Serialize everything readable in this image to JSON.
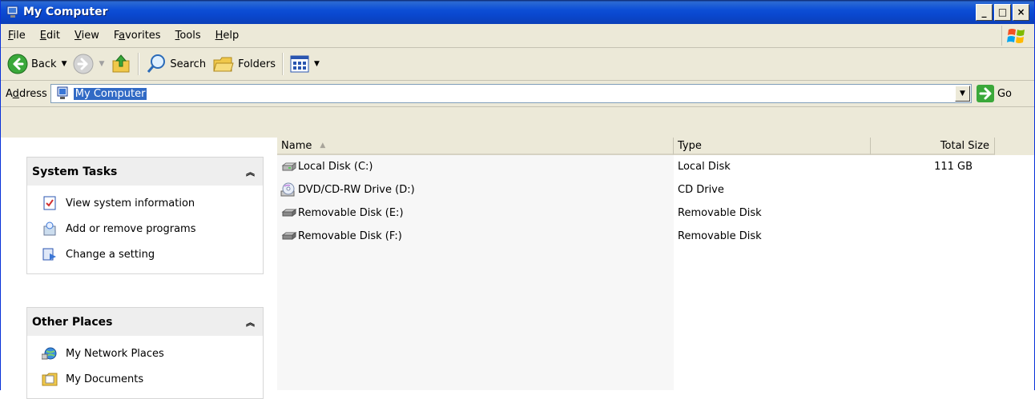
{
  "window": {
    "title": "My Computer",
    "minimize_glyph": "_",
    "maximize_glyph": "□",
    "close_glyph": "×"
  },
  "menu": {
    "items": [
      {
        "key": "F",
        "rest": "ile"
      },
      {
        "key": "E",
        "rest": "dit"
      },
      {
        "key": "V",
        "rest": "iew"
      },
      {
        "pre": "F",
        "key": "a",
        "rest": "vorites"
      },
      {
        "key": "T",
        "rest": "ools"
      },
      {
        "key": "H",
        "rest": "elp"
      }
    ]
  },
  "toolbar": {
    "back_label": "Back",
    "search_label": "Search",
    "folders_label": "Folders"
  },
  "address": {
    "label_pre": "A",
    "label_key": "d",
    "label_rest": "dress",
    "value": "My Computer",
    "go_label": "Go"
  },
  "tasks": {
    "system_title": "System Tasks",
    "system_items": [
      "View system information",
      "Add or remove programs",
      "Change a setting"
    ],
    "other_title": "Other Places",
    "other_items": [
      "My Network Places",
      "My Documents"
    ]
  },
  "list": {
    "columns": {
      "name": "Name",
      "type": "Type",
      "size": "Total Size"
    },
    "rows": [
      {
        "name": "Local Disk (C:)",
        "type": "Local Disk",
        "size": "111 GB",
        "icon": "hard-drive-icon"
      },
      {
        "name": "DVD/CD-RW Drive (D:)",
        "type": "CD Drive",
        "size": "",
        "icon": "cd-drive-icon"
      },
      {
        "name": "Removable Disk (E:)",
        "type": "Removable Disk",
        "size": "",
        "icon": "removable-disk-icon"
      },
      {
        "name": "Removable Disk (F:)",
        "type": "Removable Disk",
        "size": "",
        "icon": "removable-disk-icon"
      }
    ]
  },
  "colors": {
    "titlebar": "#0a48d0",
    "selection": "#316ac5",
    "taskpane": "#6375d6"
  }
}
